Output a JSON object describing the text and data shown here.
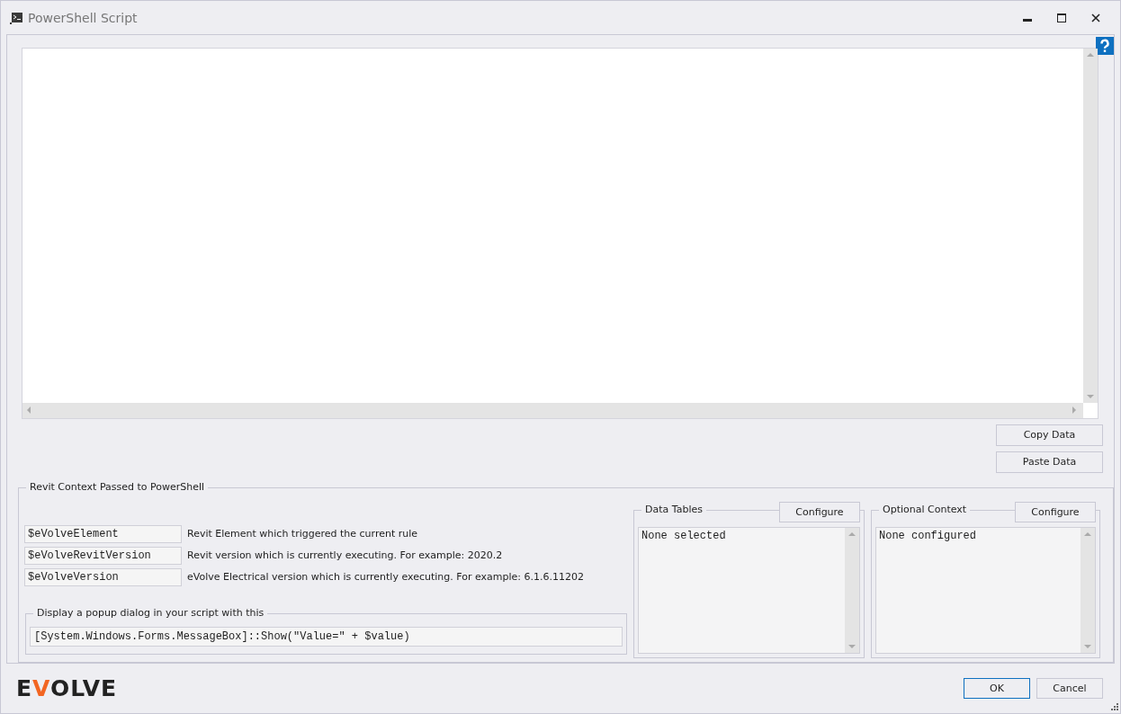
{
  "window": {
    "title": "PowerShell Script"
  },
  "clipboard_buttons": [
    "Copy Data",
    "Paste Data"
  ],
  "context_group": {
    "title": "Revit Context Passed to PowerShell",
    "variables": [
      {
        "name": "$eVolveElement",
        "description": "Revit Element which triggered the current rule"
      },
      {
        "name": "$eVolveRevitVersion",
        "description": "Revit version which is currently executing. For example: 2020.2"
      },
      {
        "name": "$eVolveVersion",
        "description": "eVolve Electrical version which is currently executing. For example: 6.1.6.11202"
      }
    ],
    "popup": {
      "title": "Display a popup dialog in your script with this",
      "code": "[System.Windows.Forms.MessageBox]::Show(\"Value=\" + $value)"
    }
  },
  "side_groups": [
    {
      "title": "Data Tables",
      "button": "Configure",
      "content": "None selected"
    },
    {
      "title": "Optional Context",
      "button": "Configure",
      "content": "None configured"
    }
  ],
  "logo": [
    {
      "text": "E",
      "accent": false
    },
    {
      "text": "V",
      "accent": true
    },
    {
      "text": "OLVE",
      "accent": false
    }
  ],
  "footer_buttons": [
    {
      "label": "OK",
      "default": true
    },
    {
      "label": "Cancel",
      "default": false
    }
  ]
}
